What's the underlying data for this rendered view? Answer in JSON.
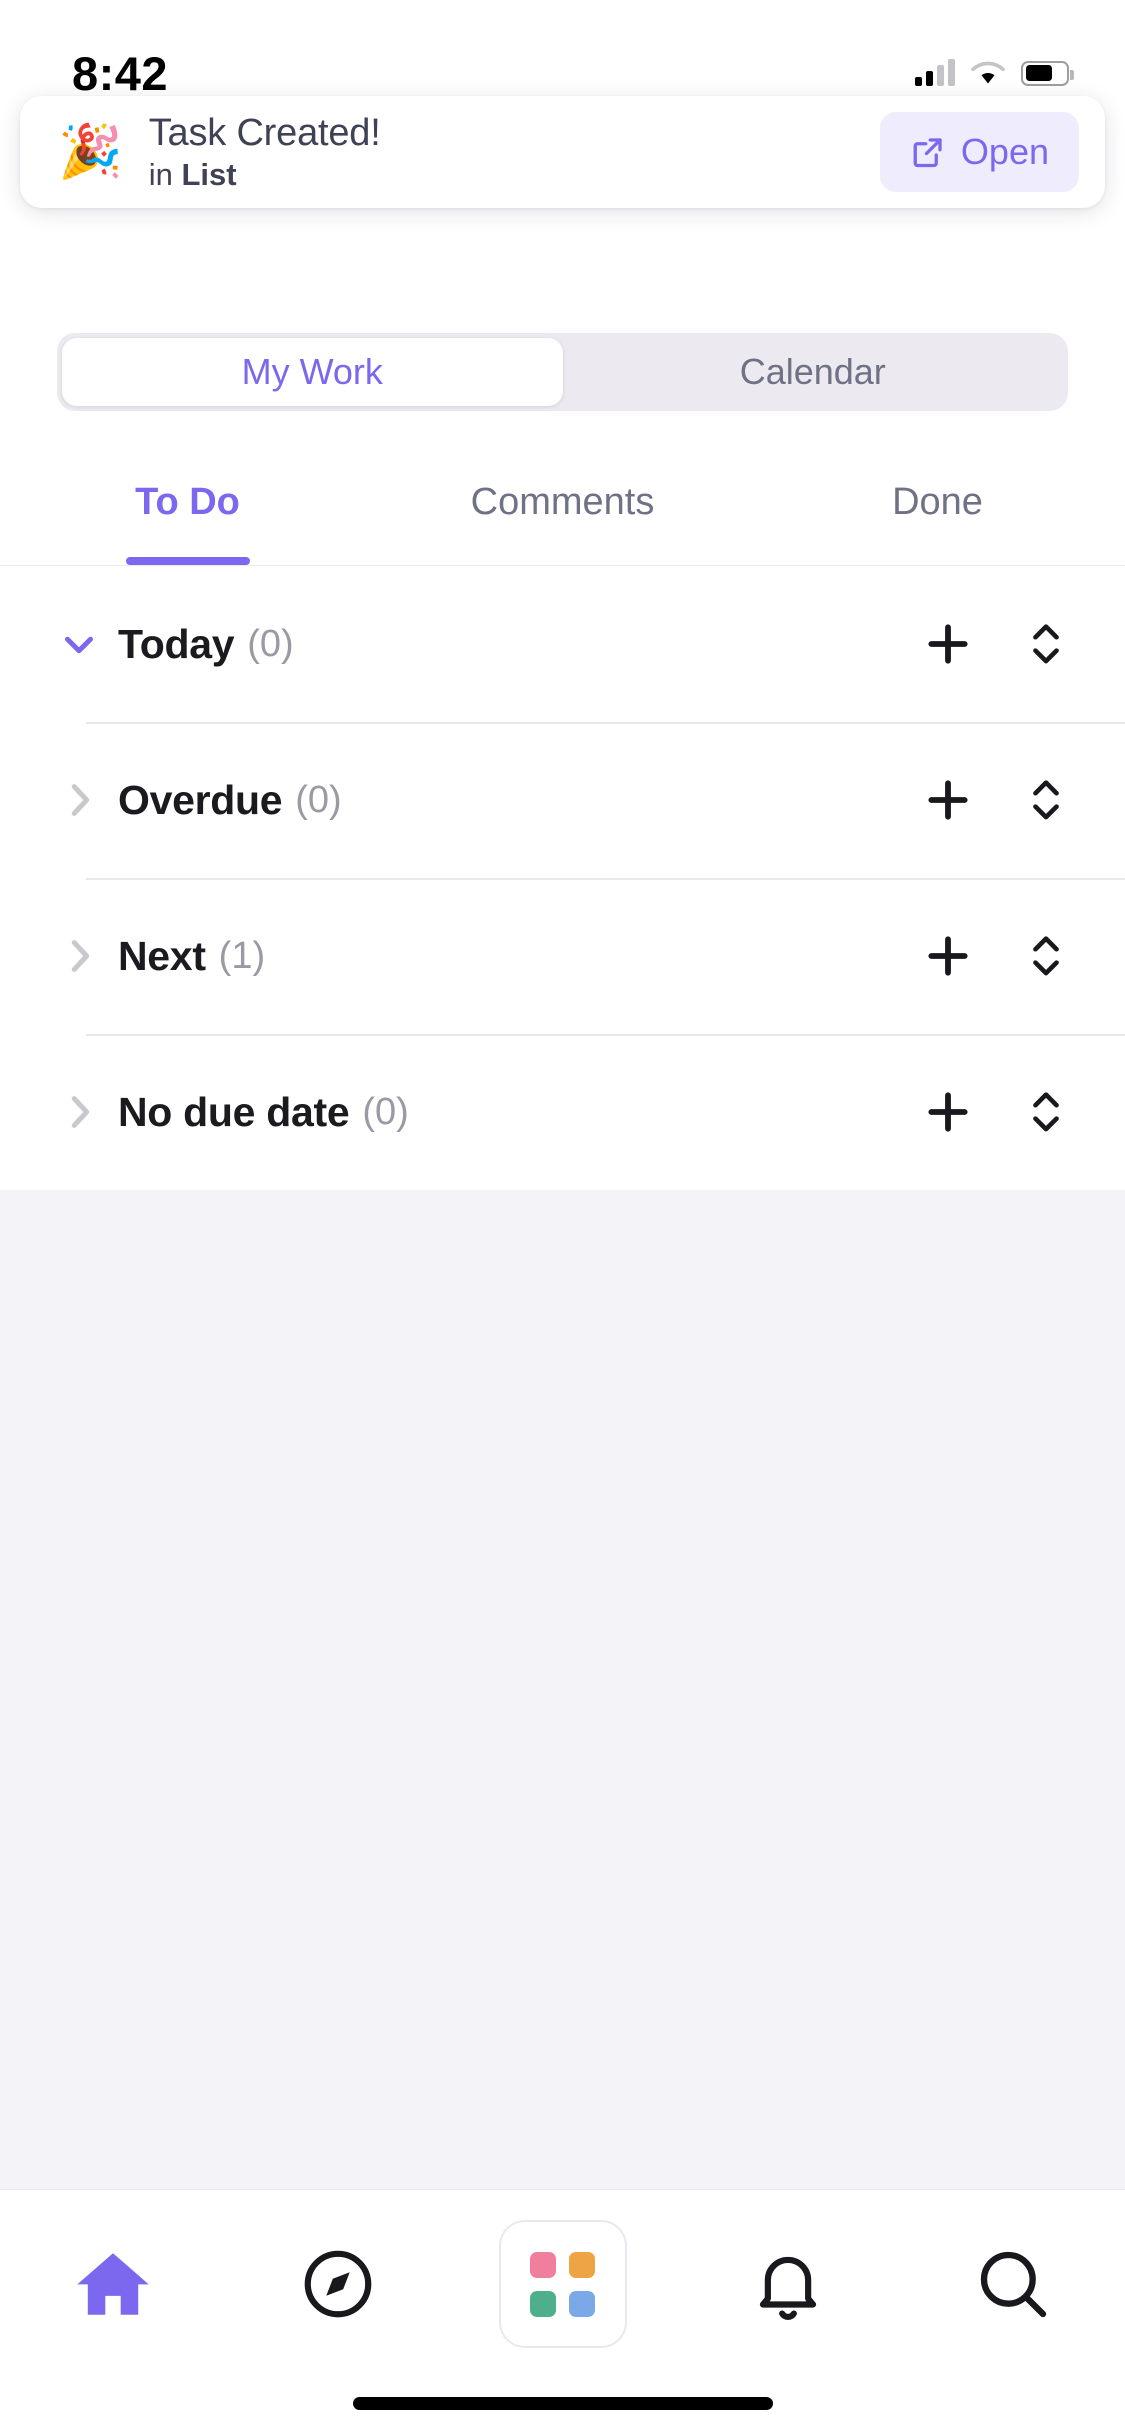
{
  "status_bar": {
    "time": "8:42",
    "signal_icon": "cellular-signal-icon",
    "wifi_icon": "wifi-icon",
    "battery_icon": "battery-icon"
  },
  "toast": {
    "emoji": "🎉",
    "emoji_name": "party-popper-emoji",
    "title": "Task Created!",
    "subtitle_prefix": "in ",
    "subtitle_target": "List",
    "open_label": "Open",
    "open_icon": "external-link-icon",
    "accent": "#7b68ee",
    "accent_bg": "#efecfd"
  },
  "segmented_control": {
    "options": [
      {
        "label": "My Work",
        "selected": true
      },
      {
        "label": "Calendar",
        "selected": false
      }
    ]
  },
  "tabs": [
    {
      "label": "To Do",
      "active": true
    },
    {
      "label": "Comments",
      "active": false
    },
    {
      "label": "Done",
      "active": false
    }
  ],
  "sections": [
    {
      "title": "Today",
      "count": "(0)",
      "expanded": true,
      "chevron": "chevron-down-icon",
      "add_icon": "plus-icon",
      "sort_icon": "sort-icon"
    },
    {
      "title": "Overdue",
      "count": "(0)",
      "expanded": false,
      "chevron": "chevron-right-icon",
      "add_icon": "plus-icon",
      "sort_icon": "sort-icon"
    },
    {
      "title": "Next",
      "count": "(1)",
      "expanded": false,
      "chevron": "chevron-right-icon",
      "add_icon": "plus-icon",
      "sort_icon": "sort-icon"
    },
    {
      "title": "No due date",
      "count": "(0)",
      "expanded": false,
      "chevron": "chevron-right-icon",
      "add_icon": "plus-icon",
      "sort_icon": "sort-icon"
    }
  ],
  "bottom_nav": [
    {
      "name": "home",
      "icon": "home-icon",
      "active": true
    },
    {
      "name": "explore",
      "icon": "compass-icon",
      "active": false
    },
    {
      "name": "apps",
      "icon": "app-grid-icon",
      "active": false
    },
    {
      "name": "notifications",
      "icon": "bell-icon",
      "active": false
    },
    {
      "name": "search",
      "icon": "search-icon",
      "active": false
    }
  ],
  "app_grid_colors": {
    "top_left": "#ef7f9d",
    "top_right": "#eea345",
    "bottom_left": "#4fae8b",
    "bottom_right": "#7aa8e8"
  },
  "theme": {
    "accent_purple": "#7b68ee",
    "text_dark": "#1a1a1f",
    "text_muted": "#9a9aa5",
    "empty_bg": "#f4f4f8"
  }
}
